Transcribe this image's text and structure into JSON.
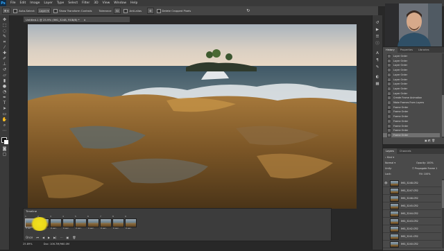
{
  "app": {
    "logo": "Ps"
  },
  "menu": [
    "File",
    "Edit",
    "Image",
    "Layer",
    "Type",
    "Select",
    "Filter",
    "3D",
    "View",
    "Window",
    "Help"
  ],
  "options": {
    "auto_select_label": "Auto-Select:",
    "auto_select_value": "Layer",
    "transform_controls_label": "Show Transform Controls",
    "tolerance_label": "Tolerance",
    "tolerance_value": "32",
    "anti_alias_label": "Anti-alias",
    "delete_cropped_label": "Delete Cropped Pixels"
  },
  "document": {
    "tab_title": "Untitled-1 @ 25.9% (IMG_3248, RGB/8) *"
  },
  "timeline": {
    "title": "Timeline",
    "frames": [
      {
        "num": "1",
        "delay": "0 sec."
      },
      {
        "num": "2",
        "delay": "0 sec."
      },
      {
        "num": "3",
        "delay": "0 sec."
      },
      {
        "num": "4",
        "delay": "0 sec."
      },
      {
        "num": "5",
        "delay": "0 sec."
      },
      {
        "num": "6",
        "delay": "0 sec."
      },
      {
        "num": "7",
        "delay": "0 sec."
      },
      {
        "num": "8",
        "delay": "0 sec."
      },
      {
        "num": "9",
        "delay": "0 sec."
      }
    ],
    "loop_value": "Once"
  },
  "status": {
    "zoom": "25.89%",
    "doc_size": "Doc: 106.7M/960.0M"
  },
  "history": {
    "tabs": [
      "History",
      "Properties",
      "Libraries"
    ],
    "items": [
      "Layer Order",
      "Layer Order",
      "Layer Order",
      "Layer Order",
      "Layer Order",
      "Layer Order",
      "Layer Order",
      "Layer Order",
      "Layer Order",
      "Create Frame Animation",
      "Make Frames From Layers",
      "Frame Order",
      "Frame Order",
      "Frame Order",
      "Frame Order",
      "Frame Order",
      "Frame Order",
      "Frame Order"
    ]
  },
  "layers": {
    "tabs": [
      "Layers",
      "Channels"
    ],
    "kind_label": "Kind",
    "blend_mode": "Normal",
    "opacity_label": "Opacity:",
    "opacity_value": "100%",
    "unify_label": "Unify:",
    "propagate_label": "Propagate Frame 1",
    "lock_label": "Lock:",
    "fill_label": "Fill:",
    "fill_value": "100%",
    "items": [
      "IMG_3248.CR2",
      "IMG_3247.CR2",
      "IMG_3246.CR2",
      "IMG_3245.CR2",
      "IMG_3244.CR2",
      "IMG_3243.CR2",
      "IMG_3242.CR2",
      "IMG_3241.CR2",
      "IMG_3240.CR2"
    ]
  },
  "colors": {
    "accent": "#31a8ff",
    "highlight": "#f2e21e",
    "panel": "#4a4a4a",
    "bg": "#282828"
  }
}
